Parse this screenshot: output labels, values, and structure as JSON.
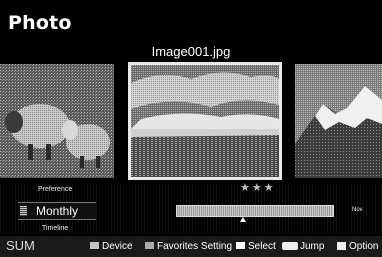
{
  "header": {
    "title": "Photo"
  },
  "viewer": {
    "current_file": "Image001.jpg",
    "rating_stars": "★★★"
  },
  "preference": {
    "label": "Preference",
    "value": "Monthly"
  },
  "timeline": {
    "label": "Timeline",
    "end_label": "Nov"
  },
  "status_bar": {
    "left_label": "SUM",
    "items": [
      {
        "label": "Device",
        "key_color": "#c2c2c2"
      },
      {
        "label": "Favorites Setting",
        "key_color": "#aaaaaa"
      },
      {
        "label": "Select",
        "key_color": "#ffffff"
      },
      {
        "label": "Jump",
        "key_icon": "skip-buttons-icon"
      },
      {
        "label": "Option",
        "key_icon": "tools-icon"
      }
    ]
  }
}
